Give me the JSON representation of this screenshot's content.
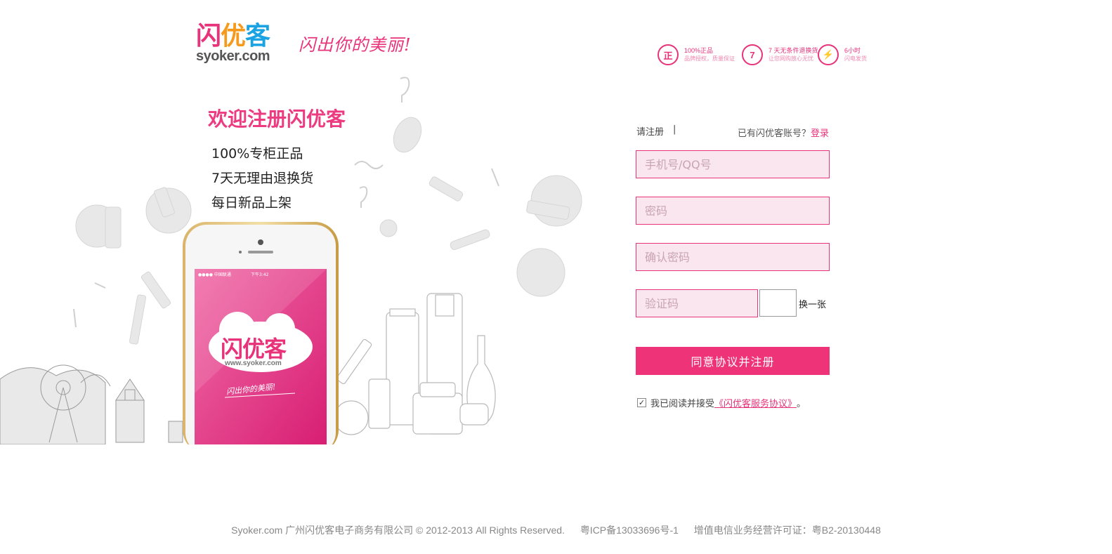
{
  "header": {
    "logo": {
      "cn_part1": "闪",
      "cn_part2": "优",
      "cn_part3": "客",
      "en": "syoker.com"
    },
    "slogan": "闪出你的美丽!",
    "promises": [
      {
        "icon": "正",
        "line1": "100%正品",
        "line2": "品牌授权，质量保证"
      },
      {
        "icon": "7",
        "line1": "7 天无条件退换货",
        "line2": "让您网购放心无忧"
      },
      {
        "icon": "⚡",
        "line1": "6小时",
        "line2": "闪电发货"
      }
    ]
  },
  "promo": {
    "welcome": "欢迎注册闪优客",
    "features": [
      "100%专柜正品",
      "7天无理由退换货",
      "每日新品上架"
    ]
  },
  "phone_screen": {
    "status_carrier": "●●●● 中国联通",
    "status_time": "下午3:42",
    "app_logo": "闪优客",
    "app_url": "www.syoker.com",
    "app_slogan": "闪出你的美丽!"
  },
  "form": {
    "tab_register": "请注册",
    "tab_sep": "|",
    "have_account": "已有闪优客账号？",
    "login_link": "登录",
    "phone_placeholder": "手机号/QQ号",
    "password_placeholder": "密码",
    "confirm_placeholder": "确认密码",
    "captcha_placeholder": "验证码",
    "captcha_refresh": "换一张",
    "submit_label": "同意协议并注册",
    "agree_prefix": "我已阅读并接受",
    "agree_link": "《闪优客服务协议》",
    "agree_suffix": "。",
    "agree_checked": true
  },
  "footer": {
    "copyright": "Syoker.com 广州闪优客电子商务有限公司 © 2012-2013 All Rights Reserved.",
    "icp": "粤ICP备13033696号-1",
    "license": "增值电信业务经营许可证：粤B2-20130448"
  },
  "colors": {
    "brand_pink": "#ee3378",
    "field_bg": "#fae6ef",
    "orange": "#f59a1c",
    "blue": "#19a3e2"
  }
}
